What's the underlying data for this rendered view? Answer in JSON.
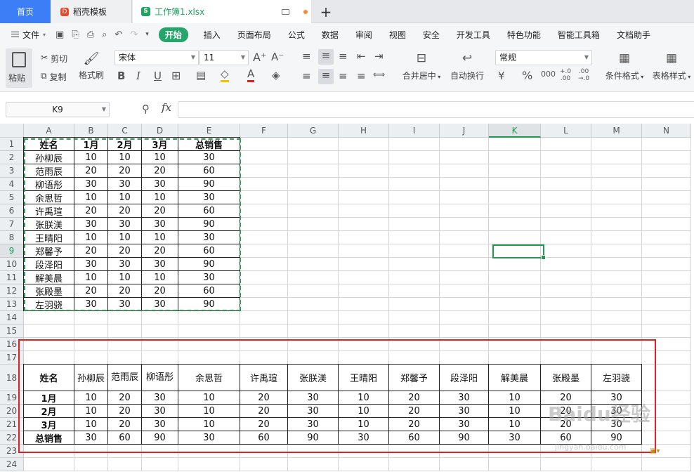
{
  "tabs": {
    "home": "首页",
    "template": "稻壳模板",
    "workbook": "工作簿1.xlsx",
    "add": "+"
  },
  "menu": {
    "file": "文件",
    "items": [
      "开始",
      "插入",
      "页面布局",
      "公式",
      "数据",
      "审阅",
      "视图",
      "安全",
      "开发工具",
      "特色功能",
      "智能工具箱",
      "文档助手"
    ]
  },
  "toolbar": {
    "paste": "粘贴",
    "cut": "剪切",
    "copy": "复制",
    "format_painter": "格式刷",
    "font_name": "宋体",
    "font_size": "11",
    "merge_center": "合并居中",
    "auto_wrap": "自动换行",
    "number_format": "常规",
    "conditional_format": "条件格式",
    "table_style": "表格样式"
  },
  "formula_bar": {
    "name_box": "K9",
    "fx": "fx",
    "formula": ""
  },
  "columns": [
    "A",
    "B",
    "C",
    "D",
    "E",
    "F",
    "G",
    "H",
    "I",
    "J",
    "K",
    "L",
    "M",
    "N"
  ],
  "rows": [
    "1",
    "2",
    "3",
    "4",
    "5",
    "6",
    "7",
    "8",
    "9",
    "10",
    "11",
    "12",
    "13",
    "14",
    "15",
    "16",
    "17",
    "18",
    "19",
    "20",
    "21",
    "22",
    "23",
    "24"
  ],
  "source_table": {
    "headers": [
      "姓名",
      "1月",
      "2月",
      "3月",
      "总销售"
    ],
    "rows": [
      [
        "孙柳辰",
        "10",
        "10",
        "10",
        "30"
      ],
      [
        "范雨辰",
        "20",
        "20",
        "20",
        "60"
      ],
      [
        "柳语彤",
        "30",
        "30",
        "30",
        "90"
      ],
      [
        "余思哲",
        "10",
        "10",
        "10",
        "30"
      ],
      [
        "许禹瑄",
        "20",
        "20",
        "20",
        "60"
      ],
      [
        "张朕渼",
        "30",
        "30",
        "30",
        "90"
      ],
      [
        "王晴阳",
        "10",
        "10",
        "10",
        "30"
      ],
      [
        "郑馨予",
        "20",
        "20",
        "20",
        "60"
      ],
      [
        "段泽阳",
        "30",
        "30",
        "30",
        "90"
      ],
      [
        "解美晨",
        "10",
        "10",
        "10",
        "30"
      ],
      [
        "张殿墨",
        "20",
        "20",
        "20",
        "60"
      ],
      [
        "左羽骁",
        "30",
        "30",
        "30",
        "90"
      ]
    ]
  },
  "transposed_table": {
    "header_row": [
      "姓名",
      "孙柳辰",
      "范雨辰",
      "柳语彤",
      "余思哲",
      "许禹瑄",
      "张朕渼",
      "王晴阳",
      "郑馨予",
      "段泽阳",
      "解美晨",
      "张殿墨",
      "左羽骁"
    ],
    "rows": [
      [
        "1月",
        "10",
        "20",
        "30",
        "10",
        "20",
        "30",
        "10",
        "20",
        "30",
        "10",
        "20",
        "30"
      ],
      [
        "2月",
        "10",
        "20",
        "30",
        "10",
        "20",
        "30",
        "10",
        "20",
        "30",
        "10",
        "20",
        "30"
      ],
      [
        "3月",
        "10",
        "20",
        "30",
        "10",
        "20",
        "30",
        "10",
        "20",
        "30",
        "10",
        "20",
        "30"
      ],
      [
        "总销售",
        "30",
        "60",
        "90",
        "30",
        "60",
        "90",
        "30",
        "60",
        "90",
        "30",
        "60",
        "90"
      ]
    ]
  },
  "watermark": {
    "brand": "Baidu经验",
    "url": "jingyan.baidu.com"
  }
}
